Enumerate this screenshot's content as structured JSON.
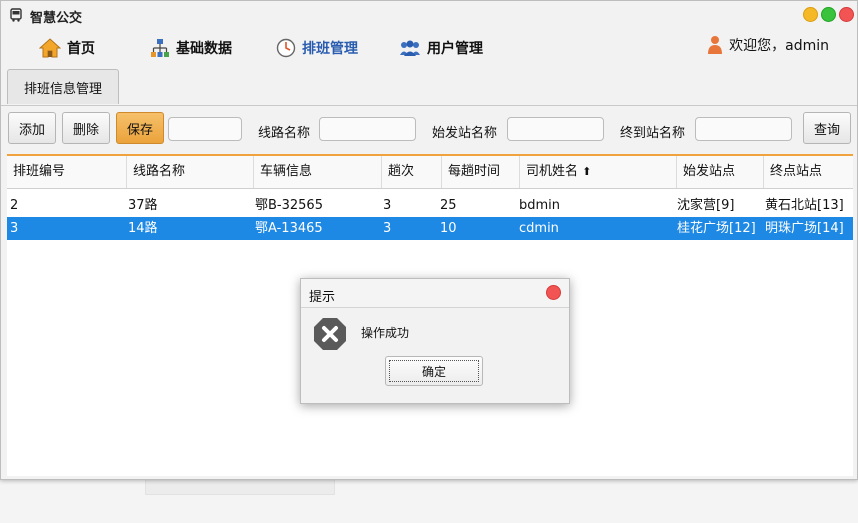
{
  "app": {
    "title": "智慧公交"
  },
  "nav": [
    {
      "label": "首页",
      "icon": "home-icon"
    },
    {
      "label": "基础数据",
      "icon": "hierarchy-icon"
    },
    {
      "label": "排班管理",
      "icon": "clock-icon"
    },
    {
      "label": "用户管理",
      "icon": "users-icon"
    }
  ],
  "user": {
    "greeting": "欢迎您，admin"
  },
  "tabs": [
    {
      "label": "排班信息管理"
    }
  ],
  "toolbar": {
    "add_label": "添加",
    "delete_label": "删除",
    "save_label": "保存",
    "keyword_value": "",
    "line_label": "线路名称",
    "line_value": "",
    "start_label": "始发站名称",
    "start_value": "",
    "end_label": "终到站名称",
    "end_value": "",
    "query_label": "查询"
  },
  "table": {
    "columns": [
      "排班编号",
      "线路名称",
      "车辆信息",
      "趟次",
      "每趟时间",
      "司机姓名",
      "始发站点",
      "终点站点"
    ],
    "sorted_column_indicator": "⬆",
    "rows": [
      [
        "2",
        "37路",
        "鄂B-32565",
        "3",
        "25",
        "bdmin",
        "沈家营[9]",
        "黄石北站[13]"
      ],
      [
        "3",
        "14路",
        "鄂A-13465",
        "3",
        "10",
        "cdmin",
        "桂花广场[12]",
        "明珠广场[14]"
      ]
    ],
    "selected_row": 1
  },
  "dialog": {
    "title": "提示",
    "message": "操作成功",
    "ok_label": "确定",
    "icon": "error-x-icon"
  },
  "colors": {
    "accent_orange": "#f0a33c",
    "selection_blue": "#1e88e5",
    "active_nav": "#2a5db0",
    "close_red": "#f25454"
  }
}
